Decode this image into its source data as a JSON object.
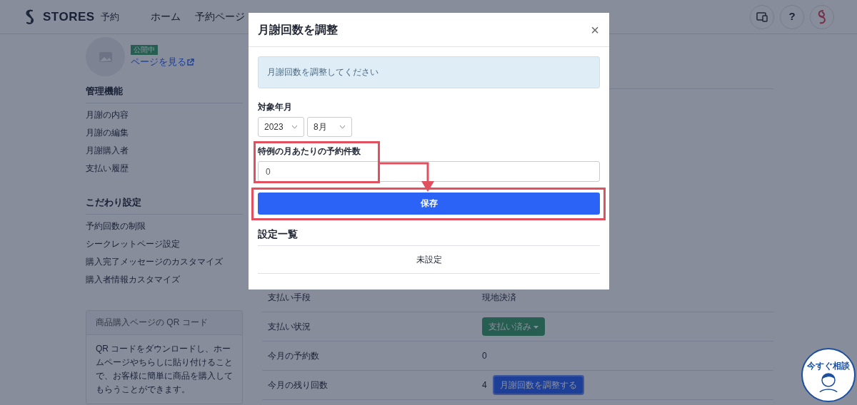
{
  "header": {
    "logo_text": "STORES",
    "logo_sub": "予約",
    "nav": [
      "ホーム",
      "予約ページ"
    ],
    "help": "?"
  },
  "sidebar": {
    "status_badge": "公開中",
    "view_link": "ページを見る",
    "sections": [
      {
        "title": "管理機能",
        "items": [
          "月謝の内容",
          "月謝の編集",
          "月謝購入者",
          "支払い履歴"
        ]
      },
      {
        "title": "こだわり設定",
        "items": [
          "予約回数の制限",
          "シークレットページ設定",
          "購入完了メッセージのカスタマイズ",
          "購入者情報カスタマイズ"
        ]
      }
    ],
    "qr_card": {
      "title": "商品購入ページの QR コード",
      "body": "QR コードをダウンロードし、ホームページやちらしに貼り付けることで、お客様に簡単に商品を購入してもらうことができます。"
    }
  },
  "details": {
    "rows": [
      {
        "label": "支払い手段",
        "kind": "text",
        "value": "現地決済"
      },
      {
        "label": "支払い状況",
        "kind": "dropdown",
        "value": "支払い済み"
      },
      {
        "label": "今月の予約数",
        "kind": "text",
        "value": "0"
      },
      {
        "label": "今月の残り回数",
        "kind": "action",
        "value": "4",
        "action": "月謝回数を調整する"
      }
    ]
  },
  "modal": {
    "title": "月謝回数を調整",
    "close": "×",
    "alert": "月謝回数を調整してください",
    "year_month_label": "対象年月",
    "year": "2023",
    "month": "8月",
    "count_label": "特例の月あたりの予約件数",
    "count_value": "0",
    "save_button": "保存",
    "settings_title": "設定一覧",
    "settings_rows": [
      "未設定"
    ]
  },
  "chat_widget": {
    "label": "今すぐ相談"
  }
}
